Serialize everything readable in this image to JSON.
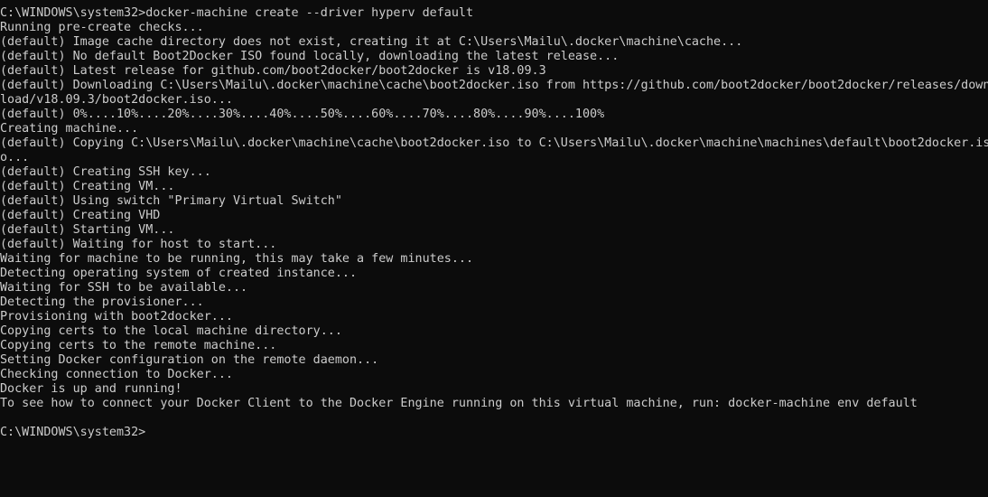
{
  "terminal": {
    "lines": [
      "C:\\WINDOWS\\system32>docker-machine create --driver hyperv default",
      "Running pre-create checks...",
      "(default) Image cache directory does not exist, creating it at C:\\Users\\Mailu\\.docker\\machine\\cache...",
      "(default) No default Boot2Docker ISO found locally, downloading the latest release...",
      "(default) Latest release for github.com/boot2docker/boot2docker is v18.09.3",
      "(default) Downloading C:\\Users\\Mailu\\.docker\\machine\\cache\\boot2docker.iso from https://github.com/boot2docker/boot2docker/releases/down",
      "load/v18.09.3/boot2docker.iso...",
      "(default) 0%....10%....20%....30%....40%....50%....60%....70%....80%....90%....100%",
      "Creating machine...",
      "(default) Copying C:\\Users\\Mailu\\.docker\\machine\\cache\\boot2docker.iso to C:\\Users\\Mailu\\.docker\\machine\\machines\\default\\boot2docker.is",
      "o...",
      "(default) Creating SSH key...",
      "(default) Creating VM...",
      "(default) Using switch \"Primary Virtual Switch\"",
      "(default) Creating VHD",
      "(default) Starting VM...",
      "(default) Waiting for host to start...",
      "Waiting for machine to be running, this may take a few minutes...",
      "Detecting operating system of created instance...",
      "Waiting for SSH to be available...",
      "Detecting the provisioner...",
      "Provisioning with boot2docker...",
      "Copying certs to the local machine directory...",
      "Copying certs to the remote machine...",
      "Setting Docker configuration on the remote daemon...",
      "Checking connection to Docker...",
      "Docker is up and running!",
      "To see how to connect your Docker Client to the Docker Engine running on this virtual machine, run: docker-machine env default",
      "",
      "C:\\WINDOWS\\system32>"
    ]
  },
  "colors": {
    "background": "#0c0c0c",
    "foreground": "#cccccc"
  }
}
